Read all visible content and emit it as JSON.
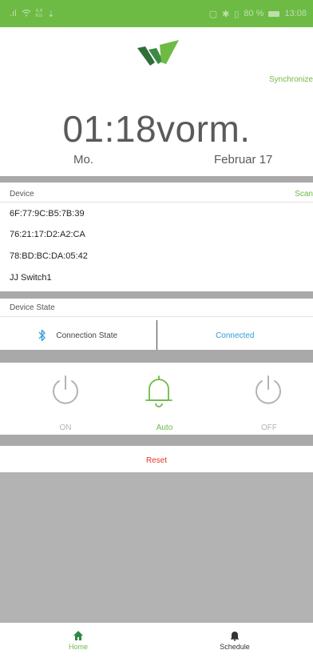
{
  "status_bar": {
    "signal": ".ıl",
    "data_rate_top": "4,4",
    "data_rate_bottom": "K/s",
    "battery_percent": "80 %",
    "time": "13:08"
  },
  "header": {
    "synchronize_label": "Synchronize"
  },
  "clock": {
    "time": "01:18vorm.",
    "weekday": "Mo.",
    "date": "Februar 17"
  },
  "devices": {
    "section_label": "Device",
    "scan_label": "Scan",
    "items": [
      "6F:77:9C:B5:7B:39",
      "76:21:17:D2:A2:CA",
      "78:BD:BC:DA:05:42",
      "JJ Switch1"
    ]
  },
  "device_state": {
    "section_label": "Device State",
    "connection_label": "Connection State",
    "connection_value": "Connected"
  },
  "controls": {
    "on_label": "ON",
    "auto_label": "Auto",
    "off_label": "OFF"
  },
  "reset_label": "Reset",
  "bottom_nav": {
    "home_label": "Home",
    "schedule_label": "Schedule"
  },
  "colors": {
    "accent_green": "#6dbb45",
    "connected_blue": "#2d9fd8",
    "reset_red": "#e5372b",
    "separator_gray": "#a9a9a9"
  }
}
